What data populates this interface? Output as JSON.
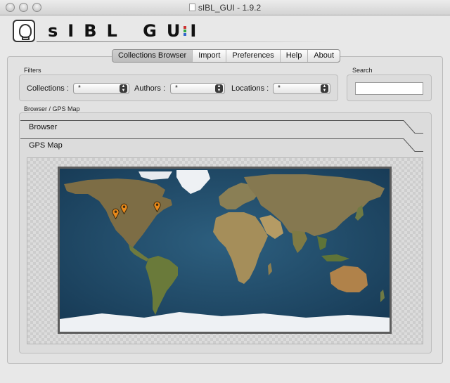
{
  "window": {
    "title": "sIBL_GUI - 1.9.2"
  },
  "logo": {
    "text": "sIBL GUI",
    "bar_colors": [
      "#cc3333",
      "#33aa44",
      "#3366cc"
    ]
  },
  "tabs": [
    {
      "label": "Collections Browser",
      "active": true
    },
    {
      "label": "Import",
      "active": false
    },
    {
      "label": "Preferences",
      "active": false
    },
    {
      "label": "Help",
      "active": false
    },
    {
      "label": "About",
      "active": false
    }
  ],
  "filters": {
    "group_label": "Filters",
    "collections": {
      "label": "Collections :",
      "value": "*"
    },
    "authors": {
      "label": "Authors :",
      "value": "*"
    },
    "locations": {
      "label": "Locations :",
      "value": "*"
    }
  },
  "search": {
    "group_label": "Search",
    "value": ""
  },
  "browser": {
    "group_label": "Browser / GPS Map",
    "sections": [
      {
        "label": "Browser"
      },
      {
        "label": "GPS Map"
      }
    ]
  },
  "map": {
    "ocean_color": "#1f4a68",
    "land_color": "#8a7a52",
    "ice_color": "#eef1f4",
    "marker_color": "#e8891a"
  }
}
